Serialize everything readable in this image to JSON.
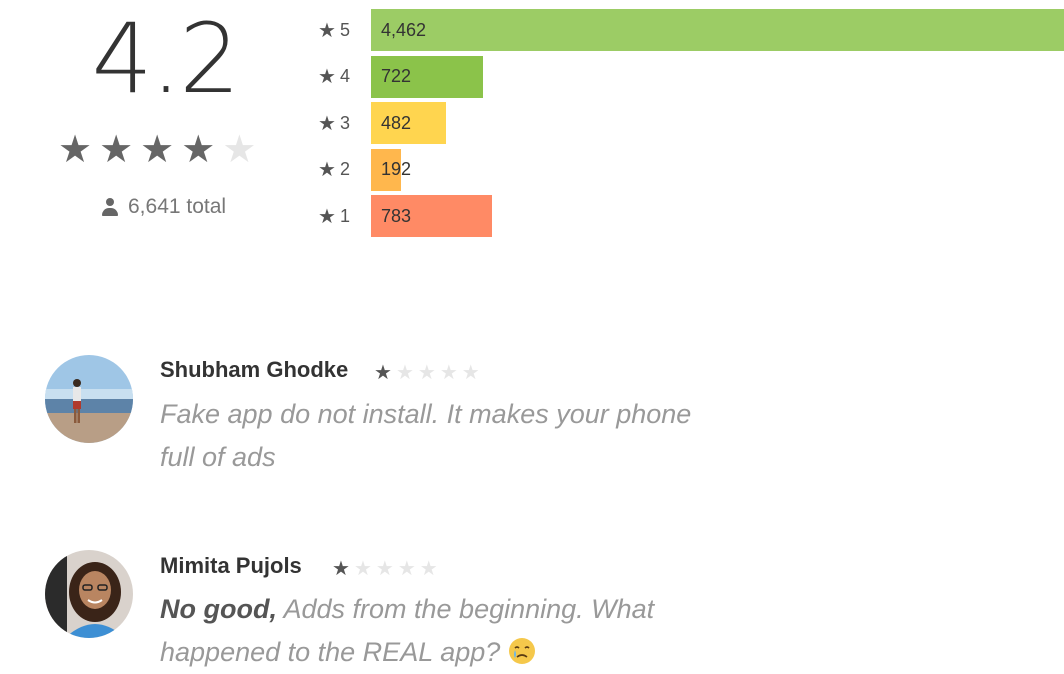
{
  "rating_summary": {
    "score": "4.2",
    "stars": [
      true,
      true,
      true,
      true,
      false
    ],
    "total": "6,641 total"
  },
  "histogram": [
    {
      "star": "5",
      "count": "4,462",
      "fraction": 1.0,
      "color": "#9ccc65"
    },
    {
      "star": "4",
      "count": "722",
      "fraction": 0.162,
      "color": "#8bc34a"
    },
    {
      "star": "3",
      "count": "482",
      "fraction": 0.108,
      "color": "#ffd54f"
    },
    {
      "star": "2",
      "count": "192",
      "fraction": 0.043,
      "color": "#ffb74d"
    },
    {
      "star": "1",
      "count": "783",
      "fraction": 0.175,
      "color": "#ff8a65"
    }
  ],
  "reviews": [
    {
      "author": "Shubham Ghodke",
      "rating": 1,
      "text_bold": "",
      "text": "Fake app do not install. It makes your phone full of ads"
    },
    {
      "author": "Mimita Pujols",
      "rating": 1,
      "text_bold": "No good,",
      "text": " Adds from the beginning. What happened to the REAL app?"
    }
  ],
  "icons": {
    "star": "★",
    "person": "person-icon",
    "emoji": "crying-face-emoji"
  }
}
